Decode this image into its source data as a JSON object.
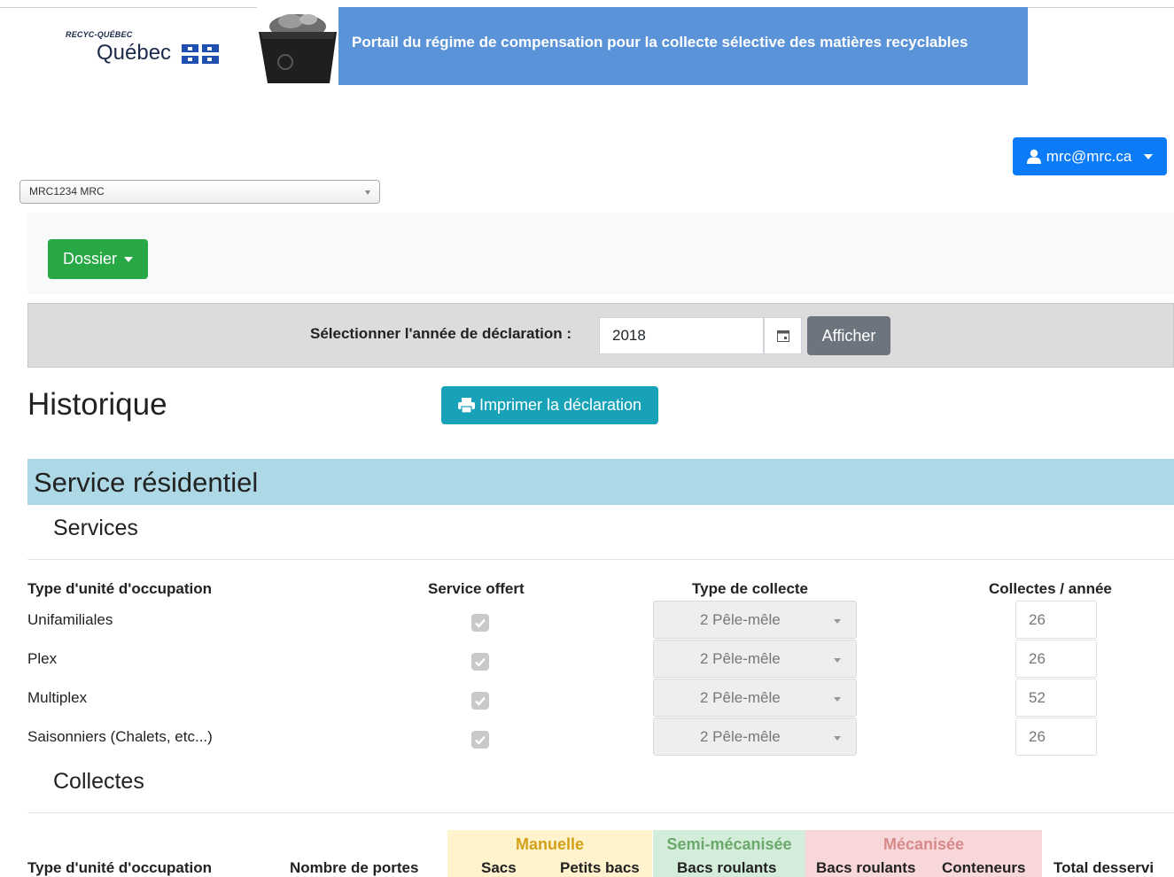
{
  "header": {
    "logo_small": "RECYC-QUÉBEC",
    "logo_main": "Québec",
    "banner_title": "Portail du régime de compensation pour la collecte sélective des matières recyclables"
  },
  "user": {
    "email": "mrc@mrc.ca",
    "icon": "user-icon"
  },
  "organization": {
    "selected": "MRC1234 MRC"
  },
  "nav": {
    "dossier_label": "Dossier"
  },
  "year_selector": {
    "label": "Sélectionner l'année de déclaration :",
    "value": "2018",
    "show_label": "Afficher"
  },
  "page": {
    "title": "Historique",
    "print_label": "Imprimer la déclaration"
  },
  "section": {
    "title": "Service résidentiel"
  },
  "services": {
    "title": "Services",
    "columns": {
      "type": "Type d'unité d'occupation",
      "service": "Service offert",
      "collecte": "Type de collecte",
      "per_year": "Collectes / année"
    },
    "rows": [
      {
        "type": "Unifamiliales",
        "offered": true,
        "collecte": "2 Pêle-mêle",
        "per_year": "26"
      },
      {
        "type": "Plex",
        "offered": true,
        "collecte": "2 Pêle-mêle",
        "per_year": "26"
      },
      {
        "type": "Multiplex",
        "offered": true,
        "collecte": "2 Pêle-mêle",
        "per_year": "52"
      },
      {
        "type": "Saisonniers (Chalets, etc...)",
        "offered": true,
        "collecte": "2 Pêle-mêle",
        "per_year": "26"
      }
    ]
  },
  "collectes": {
    "title": "Collectes",
    "groups": {
      "manuelle": "Manuelle",
      "semi": "Semi-mécanisée",
      "mecanisee": "Mécanisée"
    },
    "columns": {
      "type": "Type d'unité d'occupation",
      "portes": "Nombre de portes",
      "sacs": "Sacs",
      "petits_bacs": "Petits bacs",
      "bacs_roulants_semi": "Bacs roulants",
      "bacs_roulants_mec": "Bacs roulants",
      "conteneurs": "Conteneurs",
      "total": "Total desservi"
    },
    "colors": {
      "manuelle_bg": "#fff3cd",
      "semi_bg": "#d4edda",
      "mecanisee_bg": "#f8d7da"
    }
  }
}
